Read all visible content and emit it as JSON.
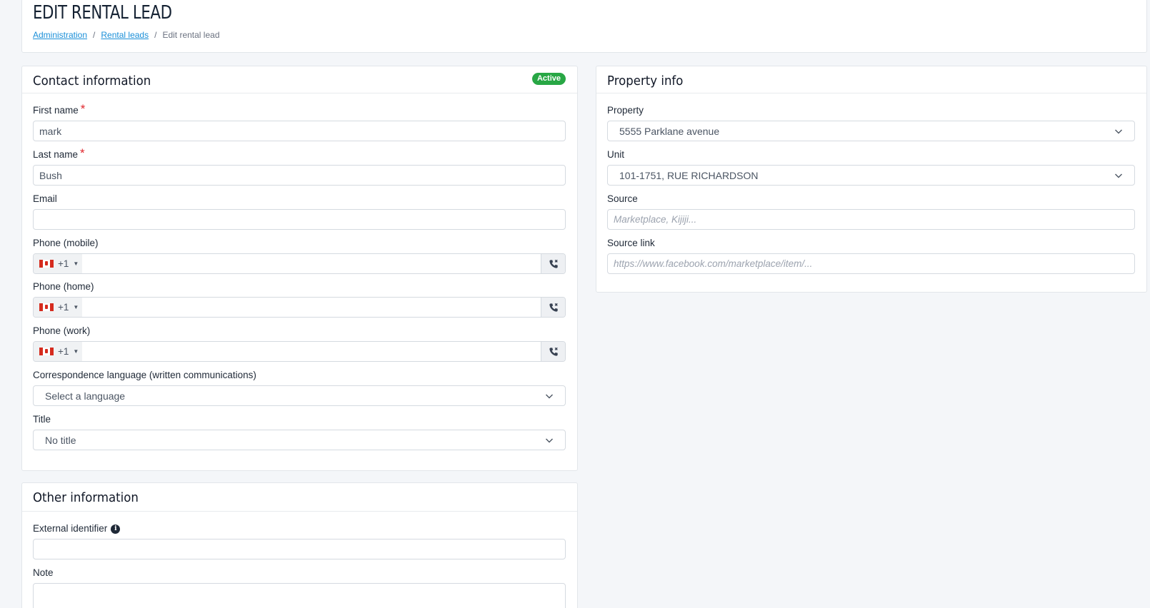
{
  "header": {
    "title": "EDIT RENTAL LEAD",
    "breadcrumb": {
      "item1": "Administration",
      "item2": "Rental leads",
      "current": "Edit rental lead",
      "separator": "/"
    }
  },
  "contact": {
    "title": "Contact information",
    "status_badge": "Active",
    "first_name": {
      "label": "First name",
      "required": "*",
      "value": "mark"
    },
    "last_name": {
      "label": "Last name",
      "required": "*",
      "value": "Bush"
    },
    "email": {
      "label": "Email",
      "value": ""
    },
    "phone_mobile": {
      "label": "Phone (mobile)",
      "country_code": "+1",
      "value": ""
    },
    "phone_home": {
      "label": "Phone (home)",
      "country_code": "+1",
      "value": ""
    },
    "phone_work": {
      "label": "Phone (work)",
      "country_code": "+1",
      "value": ""
    },
    "language": {
      "label": "Correspondence language (written communications)",
      "value": "Select a language"
    },
    "title_field": {
      "label": "Title",
      "value": "No title"
    }
  },
  "other": {
    "title": "Other information",
    "external_id": {
      "label": "External identifier",
      "value": ""
    },
    "note": {
      "label": "Note",
      "value": ""
    }
  },
  "property": {
    "title": "Property info",
    "property": {
      "label": "Property",
      "value": "5555 Parklane avenue"
    },
    "unit": {
      "label": "Unit",
      "value": "101-1751, RUE RICHARDSON"
    },
    "source": {
      "label": "Source",
      "placeholder": "Marketplace, Kijiji..."
    },
    "source_link": {
      "label": "Source link",
      "placeholder": "https://www.facebook.com/marketplace/item/..."
    }
  },
  "colors": {
    "link": "#1a8fd8",
    "badge_active": "#28a745",
    "required": "#e0272d",
    "page_bg": "#f4f6f9"
  },
  "icons": {
    "chevron": "chevron-down-icon",
    "call": "phone-call-x-icon",
    "flag": "canada-flag-icon",
    "info": "info-circle-icon"
  }
}
